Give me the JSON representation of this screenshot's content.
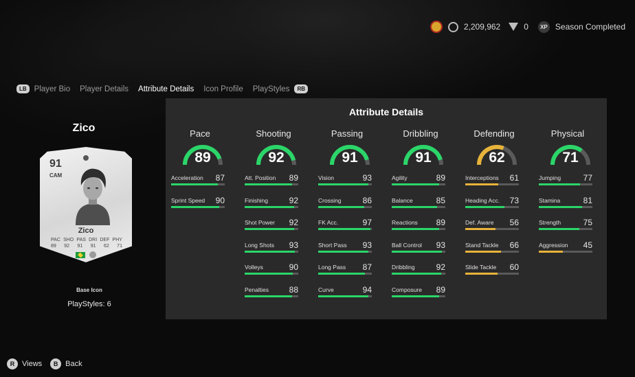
{
  "topbar": {
    "coins": "2,209,962",
    "points": "0",
    "season": "Season Completed"
  },
  "tabs": {
    "left_bumper": "LB",
    "right_bumper": "RB",
    "items": [
      "Player Bio",
      "Player Details",
      "Attribute Details",
      "Icon Profile",
      "PlayStyles"
    ],
    "active": "Attribute Details"
  },
  "player": {
    "name": "Zico",
    "rating": "91",
    "position": "CAM",
    "card_name": "Zico",
    "stat_labels": [
      "PAC",
      "SHO",
      "PAS",
      "DRI",
      "DEF",
      "PHY"
    ],
    "stat_values": [
      "89",
      "92",
      "91",
      "91",
      "62",
      "71"
    ],
    "card_type": "Base Icon",
    "playstyles": "PlayStyles: 6"
  },
  "panel": {
    "title": "Attribute Details",
    "colors": {
      "green": "#2bd669",
      "yellow": "#e8b33a",
      "track": "#5a5a5a"
    },
    "categories": [
      {
        "name": "Pace",
        "value": 89,
        "level": "green",
        "stats": [
          {
            "name": "Acceleration",
            "value": 87
          },
          {
            "name": "Sprint Speed",
            "value": 90
          }
        ]
      },
      {
        "name": "Shooting",
        "value": 92,
        "level": "green",
        "stats": [
          {
            "name": "Att. Position",
            "value": 89
          },
          {
            "name": "Finishing",
            "value": 92
          },
          {
            "name": "Shot Power",
            "value": 92
          },
          {
            "name": "Long Shots",
            "value": 93
          },
          {
            "name": "Volleys",
            "value": 90
          },
          {
            "name": "Penalties",
            "value": 88
          }
        ]
      },
      {
        "name": "Passing",
        "value": 91,
        "level": "green",
        "stats": [
          {
            "name": "Vision",
            "value": 93
          },
          {
            "name": "Crossing",
            "value": 86
          },
          {
            "name": "FK Acc.",
            "value": 97
          },
          {
            "name": "Short Pass",
            "value": 93
          },
          {
            "name": "Long Pass",
            "value": 87
          },
          {
            "name": "Curve",
            "value": 94
          }
        ]
      },
      {
        "name": "Dribbling",
        "value": 91,
        "level": "green",
        "stats": [
          {
            "name": "Agility",
            "value": 89
          },
          {
            "name": "Balance",
            "value": 85
          },
          {
            "name": "Reactions",
            "value": 89
          },
          {
            "name": "Ball Control",
            "value": 93
          },
          {
            "name": "Dribbling",
            "value": 92
          },
          {
            "name": "Composure",
            "value": 89
          }
        ]
      },
      {
        "name": "Defending",
        "value": 62,
        "level": "yellow",
        "stats": [
          {
            "name": "Interceptions",
            "value": 61
          },
          {
            "name": "Heading Acc.",
            "value": 73
          },
          {
            "name": "Def. Aware",
            "value": 56
          },
          {
            "name": "Stand Tackle",
            "value": 66
          },
          {
            "name": "Slide Tackle",
            "value": 60
          }
        ]
      },
      {
        "name": "Physical",
        "value": 71,
        "level": "green",
        "stats": [
          {
            "name": "Jumping",
            "value": 77
          },
          {
            "name": "Stamina",
            "value": 81
          },
          {
            "name": "Strength",
            "value": 75
          },
          {
            "name": "Aggression",
            "value": 45
          }
        ]
      }
    ]
  },
  "bottom": {
    "views_button": "R",
    "views_label": "Views",
    "back_button": "B",
    "back_label": "Back"
  }
}
